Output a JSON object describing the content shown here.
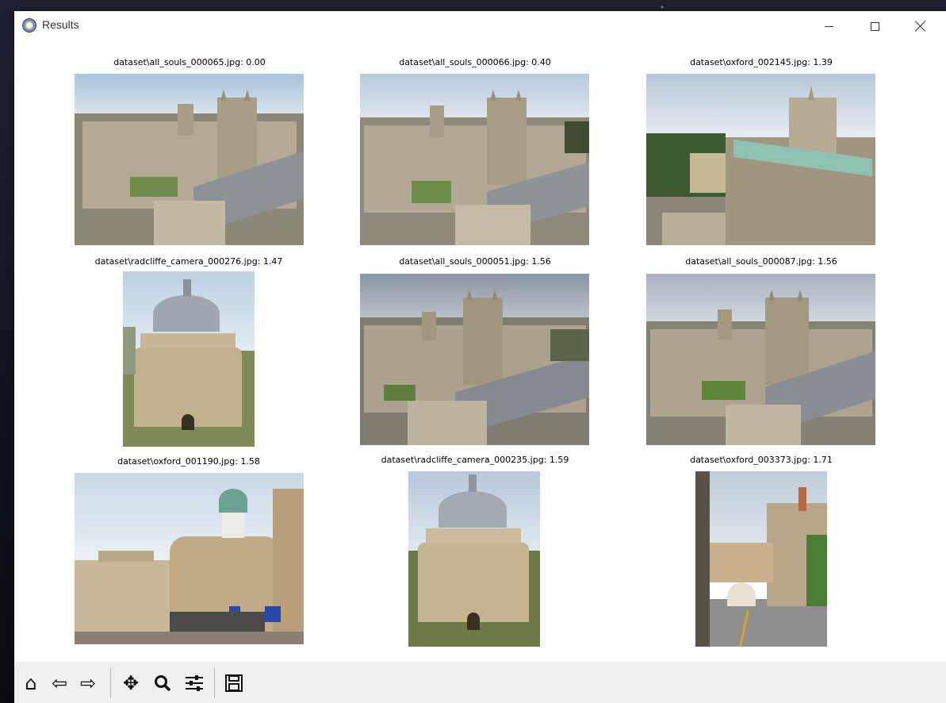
{
  "window": {
    "title": "Results"
  },
  "results": [
    {
      "caption": "dataset\\all_souls_000065.jpg: 0.00"
    },
    {
      "caption": "dataset\\all_souls_000066.jpg: 0.40"
    },
    {
      "caption": "dataset\\oxford_002145.jpg: 1.39"
    },
    {
      "caption": "dataset\\radcliffe_camera_000276.jpg: 1.47"
    },
    {
      "caption": "dataset\\all_souls_000051.jpg: 1.56"
    },
    {
      "caption": "dataset\\all_souls_000087.jpg: 1.56"
    },
    {
      "caption": "dataset\\oxford_001190.jpg: 1.58"
    },
    {
      "caption": "dataset\\radcliffe_camera_000235.jpg: 1.59"
    },
    {
      "caption": "dataset\\oxford_003373.jpg: 1.71"
    }
  ],
  "toolbar": {
    "home": "home-icon",
    "back": "back-arrow-icon",
    "forward": "forward-arrow-icon",
    "pan": "move-icon",
    "zoom": "magnifier-icon",
    "configure": "sliders-icon",
    "save": "save-icon"
  }
}
